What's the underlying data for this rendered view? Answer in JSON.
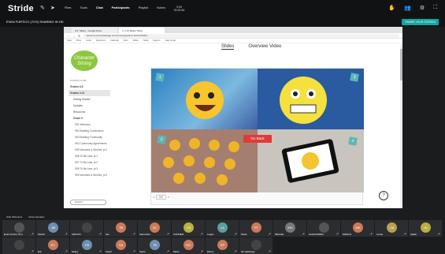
{
  "topbar": {
    "brand": "Stride",
    "menu": [
      "Files",
      "Tools",
      "Chat",
      "Participants",
      "Playlist",
      "Notes"
    ],
    "timer": "0:00\n00:20:46"
  },
  "subbar": {
    "presenter": "EVAN FURTICO (TCS) SHARING IN HD",
    "share_label": "SHARE YOUR SCREEN"
  },
  "browser": {
    "tab1": "CS: Slides - Google Drive",
    "tab2": "X | CS Slides Tiling",
    "url": "www.lms.schoolwebapp.com/course/grade-9-12/unit/slides",
    "bookmarks": [
      "Apps",
      "Drive",
      "Gmail",
      "Classroom",
      "Calendar",
      "Docs",
      "Slides",
      "Stride",
      "Reports",
      "Help Center"
    ]
  },
  "sidebar": {
    "logo_text": "Character Strong",
    "course_label": "CURRICULUM",
    "items": [
      {
        "label": "Grades 6-8",
        "kind": "grade"
      },
      {
        "label": "Grades 9-12",
        "kind": "grade sel"
      },
      {
        "label": "Getting Started",
        "kind": "sub"
      },
      {
        "label": "Updates",
        "kind": "sub"
      },
      {
        "label": "Resources",
        "kind": "sub"
      },
      {
        "label": "Grade 9",
        "kind": "bold"
      },
      {
        "label": "9S1 Welcome",
        "kind": "item"
      },
      {
        "label": "9S2 Building Connections",
        "kind": "item"
      },
      {
        "label": "9S3 Building Community",
        "kind": "item"
      },
      {
        "label": "9S4 Community Agreements",
        "kind": "item"
      },
      {
        "label": "9S5 Wonders & Worries, pt 1",
        "kind": "item"
      },
      {
        "label": "9S6 To Be Lists, pt 1",
        "kind": "item"
      },
      {
        "label": "9S7 To Be Lists, pt 2",
        "kind": "item"
      },
      {
        "label": "9S8 To Be Lists, pt 3",
        "kind": "item"
      },
      {
        "label": "9S9 Wonders & Worries, pt 2",
        "kind": "item"
      }
    ],
    "search_placeholder": "English"
  },
  "main": {
    "tabs": [
      "Slides",
      "Overview Video"
    ],
    "go_back": "Go Back",
    "tags": [
      "1",
      "3",
      "2",
      "4"
    ],
    "pager": [
      "<",
      "1/1",
      ">"
    ],
    "help": "?"
  },
  "gallery": {
    "header": [
      "Hide Webcams",
      "Active Speaker"
    ],
    "participants": [
      {
        "initials": "",
        "name": "Evan Furtico (TC)",
        "color": "#555555"
      },
      {
        "initials": "JM",
        "name": "ISAAK",
        "color": "#6f8fb0"
      },
      {
        "initials": "",
        "name": "ARCION",
        "color": "#444444"
      },
      {
        "initials": "TB",
        "name": "Sol",
        "color": "#c97a57"
      },
      {
        "initials": "SC",
        "name": "Samantha",
        "color": "#c97a57"
      },
      {
        "initials": "CS",
        "name": "CONNER",
        "color": "#b8b040"
      },
      {
        "initials": "LA",
        "name": "Logan",
        "color": "#5b9e9e"
      },
      {
        "initials": "PT",
        "name": "Parks",
        "color": "#c97a57"
      },
      {
        "initials": "MH",
        "name": "MIGUEL",
        "color": "#777777"
      },
      {
        "initials": "",
        "name": "ALEXANDRIA",
        "color": "#555555"
      },
      {
        "initials": "MK",
        "name": "MARCO",
        "color": "#c97a57"
      },
      {
        "initials": "LM",
        "name": "Lucas",
        "color": "#b8a050"
      },
      {
        "initials": "IN",
        "name": "Isaiah",
        "color": "#b8b040"
      },
      {
        "initials": "",
        "name": "",
        "color": "#444444"
      },
      {
        "initials": "EC",
        "name": "Edi",
        "color": "#c97a57"
      },
      {
        "initials": "HS",
        "name": "Hailey",
        "color": "#6f8fb0"
      },
      {
        "initials": "SA",
        "name": "Sarah",
        "color": "#c97a57"
      },
      {
        "initials": "TB",
        "name": "Taylor",
        "color": "#6f8fb0"
      },
      {
        "initials": "MC",
        "name": "Maria",
        "color": "#c97a57"
      },
      {
        "initials": "EP",
        "name": "Ebony",
        "color": "#c97a57"
      },
      {
        "initials": "",
        "name": "Mr Hathaway",
        "color": "#444444"
      }
    ]
  }
}
